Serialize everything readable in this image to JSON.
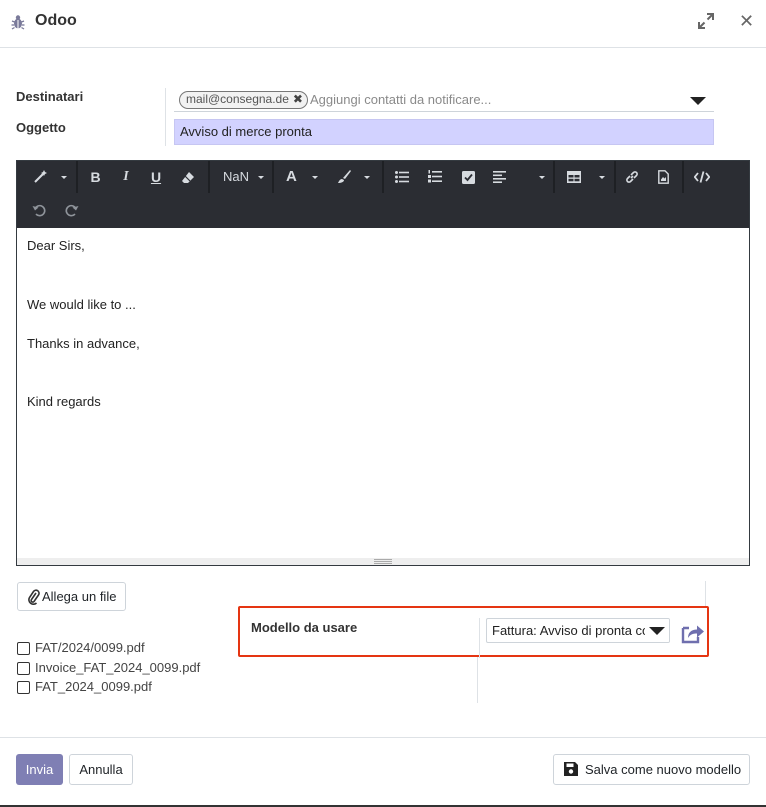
{
  "window": {
    "title": "Odoo",
    "icon": "bug-icon",
    "expand_icon": "expand-icon",
    "close_icon": "close-icon",
    "close_glyph": "✕"
  },
  "form": {
    "recipients_label": "Destinatari",
    "recipient_tag": "mail@consegna.de",
    "recipient_tag_remove": "✖",
    "recipients_placeholder": "Aggiungi contatti da notificare...",
    "subject_label": "Oggetto",
    "subject_value": "Avviso di merce pronta"
  },
  "toolbar": {
    "font_size": "NaN",
    "buttons": [
      "magic-wand",
      "bold",
      "italic",
      "underline",
      "eraser",
      "font-size",
      "font-color",
      "brush",
      "bullet-list",
      "numbered-list",
      "checklist",
      "align",
      "table",
      "link",
      "file",
      "code-view",
      "undo",
      "redo"
    ],
    "bold_glyph": "B",
    "italic_glyph": "I",
    "underline_glyph": "U",
    "font_color_glyph": "A"
  },
  "body": {
    "lines": [
      "Dear Sirs,",
      "We would like to ...",
      "Thanks in advance,",
      "Kind regards"
    ]
  },
  "attachments": {
    "button_label": "Allega un file",
    "files": [
      "FAT/2024/0099.pdf",
      "Invoice_FAT_2024_0099.pdf",
      "FAT_2024_0099.pdf"
    ]
  },
  "template": {
    "label": "Modello da usare",
    "selected": "Fattura: Avviso di pronta consegna",
    "highlight_color": "#e53512"
  },
  "footer": {
    "send_label": "Invia",
    "cancel_label": "Annulla",
    "save_template_label": "Salva come nuovo modello"
  },
  "colors": {
    "primary": "#7f7fb4",
    "subject_bg": "#d2d2ff",
    "toolbar_bg": "#2b2d33"
  }
}
